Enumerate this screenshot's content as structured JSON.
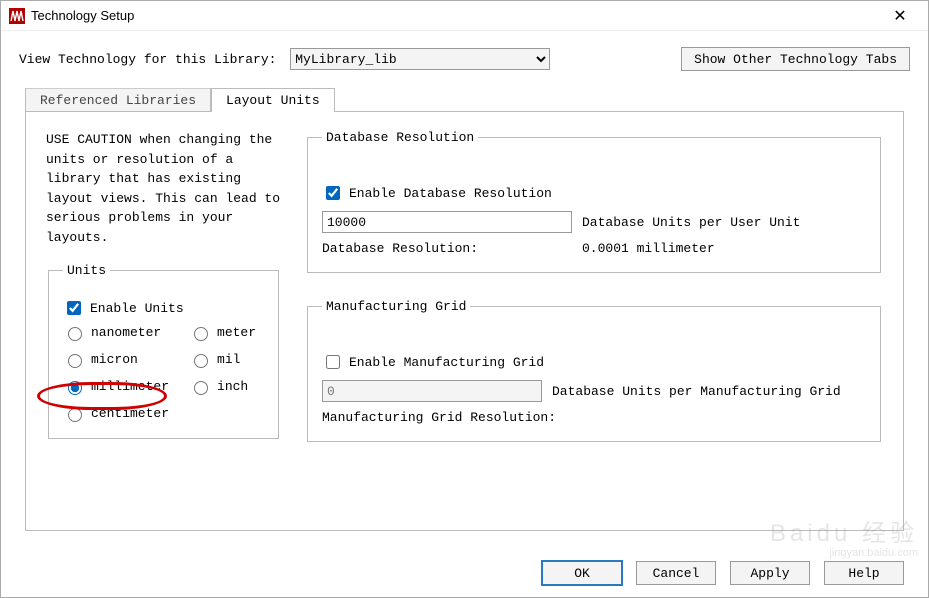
{
  "window": {
    "title": "Technology Setup"
  },
  "top": {
    "view_label": "View Technology for this Library: ",
    "library_selected": "MyLibrary_lib",
    "show_other_tabs": "Show Other Technology Tabs"
  },
  "tabs": {
    "referenced": "Referenced Libraries",
    "layout_units": "Layout Units"
  },
  "caution": "USE CAUTION when changing the units or resolution of a library that has existing layout views. This can lead to serious problems in your layouts.",
  "units": {
    "legend": "Units",
    "enable": "Enable Units",
    "opts": {
      "nanometer": "nanometer",
      "micron": "micron",
      "millimeter": "millimeter",
      "centimeter": "centimeter",
      "meter": "meter",
      "mil": "mil",
      "inch": "inch"
    }
  },
  "db_res": {
    "legend": "Database Resolution",
    "enable": "Enable Database Resolution",
    "value": "10000",
    "per_user_unit": "Database Units per User Unit",
    "res_label": "Database Resolution:",
    "res_value": "0.0001 millimeter"
  },
  "mfg": {
    "legend": "Manufacturing Grid",
    "enable": "Enable Manufacturing Grid",
    "value": "0",
    "per_grid": "Database Units per Manufacturing Grid",
    "res_label": "Manufacturing Grid Resolution:"
  },
  "buttons": {
    "ok": "OK",
    "cancel": "Cancel",
    "apply": "Apply",
    "help": "Help"
  },
  "watermark": {
    "big": "Baidu 经验",
    "small": "jingyan.baidu.com"
  }
}
